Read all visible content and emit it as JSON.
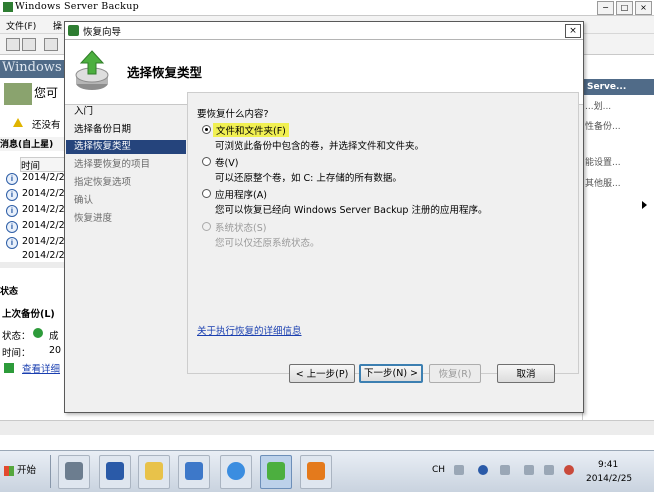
{
  "main": {
    "title": "Windows Server Backup",
    "menu": [
      "文件(F)",
      "操"
    ],
    "left_banner": "Windows",
    "bg_text1": "您可",
    "bg_text2": "还没有",
    "messages_header": "消息(自上星)",
    "time_col": "时间",
    "rows": [
      "2014/2/2",
      "2014/2/2",
      "2014/2/2",
      "2014/2/2",
      "2014/2/2",
      "2014/2/2"
    ],
    "status_header": "状态",
    "last_backup": "上次备份(L)",
    "status_label": "状态：",
    "status_value": "成",
    "time_label": "时间：",
    "time_value": "20",
    "view_details": "查看详细"
  },
  "actions": {
    "header": "Serve...",
    "items": [
      "...划...",
      "性备份...",
      "能设置...",
      "其他服..."
    ]
  },
  "dialog": {
    "title": "恢复向导",
    "heading": "选择恢复类型",
    "close": "×",
    "nav": [
      {
        "label": "入门"
      },
      {
        "label": "选择备份日期"
      },
      {
        "label": "选择恢复类型"
      },
      {
        "label": "选择要恢复的项目"
      },
      {
        "label": "指定恢复选项"
      },
      {
        "label": "确认"
      },
      {
        "label": "恢复进度"
      }
    ],
    "question": "要恢复什么内容?",
    "options": [
      {
        "label": "文件和文件夹(F)",
        "desc": "可浏览此备份中包含的卷，并选择文件和文件夹。",
        "selected": true
      },
      {
        "label": "卷(V)",
        "desc": "可以还原整个卷，如 C: 上存储的所有数据。",
        "selected": false
      },
      {
        "label": "应用程序(A)",
        "desc": "您可以恢复已经向 Windows Server Backup 注册的应用程序。",
        "selected": false
      },
      {
        "label": "系统状态(S)",
        "desc": "您可以仅还原系统状态。",
        "selected": false,
        "disabled": true
      }
    ],
    "more_info_link": "关于执行恢复的详细信息",
    "buttons": {
      "back": "< 上一步(P)",
      "next": "下一步(N) >",
      "recover": "恢复(R)",
      "cancel": "取消"
    }
  },
  "taskbar": {
    "start": "开始",
    "lang": "CH",
    "time": "9:41",
    "date": "2014/2/25"
  }
}
